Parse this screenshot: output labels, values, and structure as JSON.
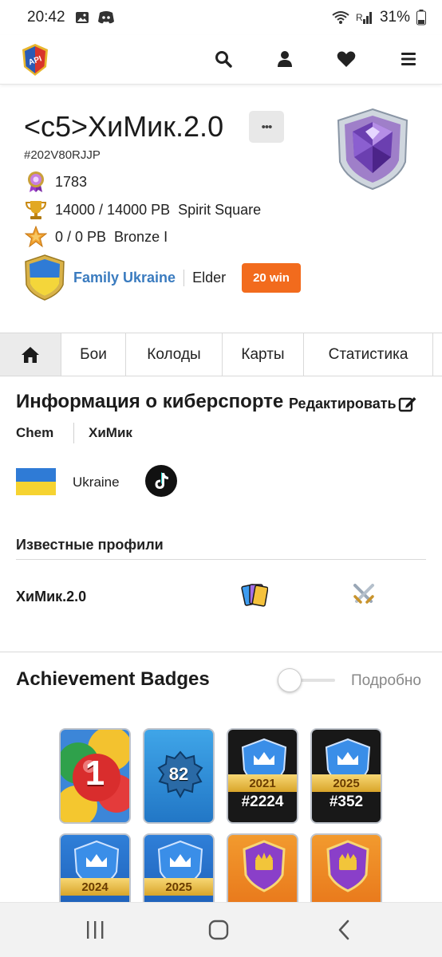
{
  "status_bar": {
    "time": "20:42",
    "battery": "31%",
    "signal_label": "R"
  },
  "navbar": {
    "logo_text": "API",
    "icons": [
      "search-icon",
      "user-icon",
      "heart-icon",
      "menu-icon"
    ]
  },
  "player": {
    "name": "<c5>ХиМик.2.0",
    "more_label": "•••",
    "tag": "#202V80RJJP",
    "trophy_road": "1783",
    "trophies": "14000 / 14000 PB",
    "arena": "Spirit Square",
    "ladder": "0 / 0 PB",
    "ladder_league": "Bronze I"
  },
  "clan": {
    "name": "Family Ukraine",
    "role": "Elder",
    "win_badge": "20 win"
  },
  "tabs": [
    {
      "label": "",
      "icon": "home-icon"
    },
    {
      "label": "Бои"
    },
    {
      "label": "Колоды"
    },
    {
      "label": "Карты"
    },
    {
      "label": "Статистика"
    }
  ],
  "esports": {
    "title": "Информация о киберспорте",
    "edit_label": "Редактировать",
    "team": "Chem",
    "nickname": "ХиМик",
    "country": "Ukraine",
    "profiles_heading": "Известные профили",
    "profile_name": "ХиМик.2.0"
  },
  "badges": {
    "title": "Achievement Badges",
    "toggle_label": "Подробно",
    "items": [
      {
        "type": "number",
        "label": "1"
      },
      {
        "type": "level",
        "label": "82"
      },
      {
        "type": "crown",
        "year": "2021",
        "rank": "#2224"
      },
      {
        "type": "crown",
        "year": "2025",
        "rank": "#352"
      },
      {
        "type": "crown-blue",
        "year": "2024"
      },
      {
        "type": "crown-blue",
        "year": "2025"
      },
      {
        "type": "shield-purple"
      },
      {
        "type": "shield-purple"
      }
    ]
  },
  "colors": {
    "accent_orange": "#f26b1d",
    "clan_link": "#3a7bbf",
    "ribbon_gold": "#e9b93d"
  }
}
